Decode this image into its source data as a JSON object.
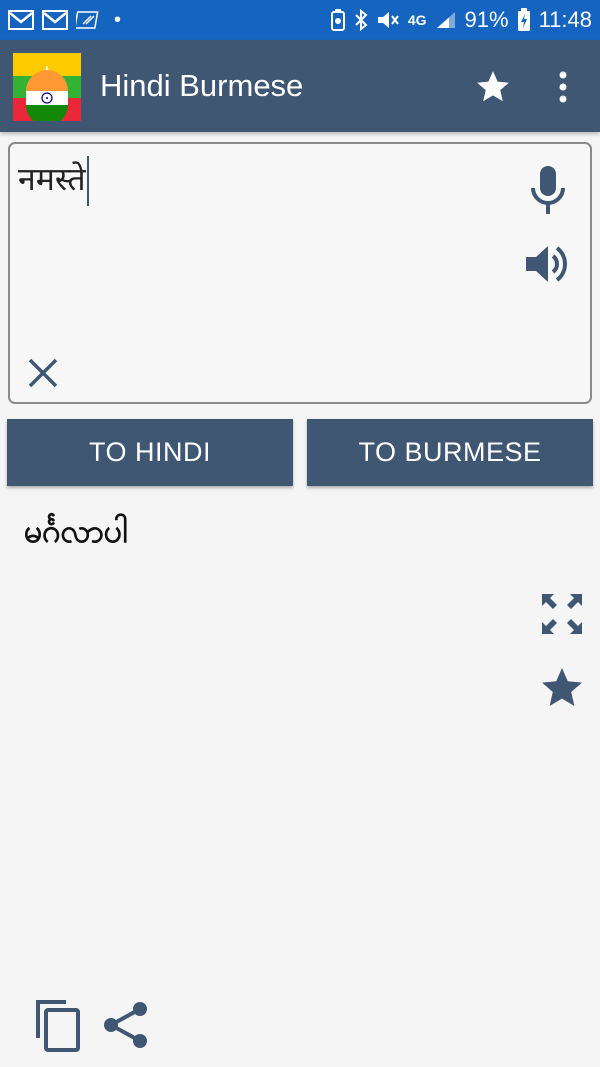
{
  "status_bar": {
    "battery": "91%",
    "time": "11:48",
    "network": "4G",
    "icons": [
      "gmail-icon",
      "gmail-icon",
      "edge-icon",
      "battery-saver-icon",
      "bluetooth-icon",
      "mute-icon",
      "signal-icon",
      "battery-charging-icon"
    ]
  },
  "app_bar": {
    "title": "Hindi Burmese",
    "flag_icon": "myanmar-india-flag-icon",
    "favorite_icon": "star-icon",
    "menu_icon": "more-vert-icon"
  },
  "input": {
    "text": "नमस्ते",
    "mic_icon": "mic-icon",
    "speaker_icon": "speaker-icon",
    "clear_icon": "close-icon"
  },
  "buttons": {
    "to_hindi": "TO HINDI",
    "to_burmese": "TO BURMESE"
  },
  "output": {
    "text": "မင်္ဂလာပါ",
    "expand_icon": "fullscreen-icon",
    "favorite_icon": "star-icon",
    "copy_icon": "copy-icon",
    "share_icon": "share-icon"
  },
  "colors": {
    "status_bar": "#1565c0",
    "primary": "#3f5773",
    "background": "#f5f5f5"
  }
}
